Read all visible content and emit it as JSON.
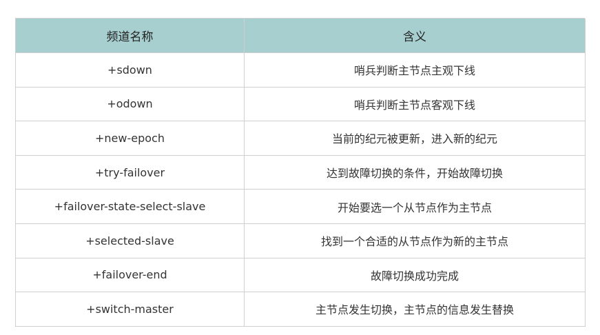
{
  "table": {
    "headers": [
      "频道名称",
      "含义"
    ],
    "rows": [
      [
        "+sdown",
        "哨兵判断主节点主观下线"
      ],
      [
        "+odown",
        "哨兵判断主节点客观下线"
      ],
      [
        "+new-epoch",
        "当前的纪元被更新，进入新的纪元"
      ],
      [
        "+try-failover",
        "达到故障切换的条件，开始故障切换"
      ],
      [
        "+failover-state-select-slave",
        "开始要选一个从节点作为主节点"
      ],
      [
        "+selected-slave",
        "找到一个合适的从节点作为新的主节点"
      ],
      [
        "+failover-end",
        "故障切换成功完成"
      ],
      [
        "+switch-master",
        "主节点发生切换，主节点的信息发生替换"
      ]
    ]
  }
}
